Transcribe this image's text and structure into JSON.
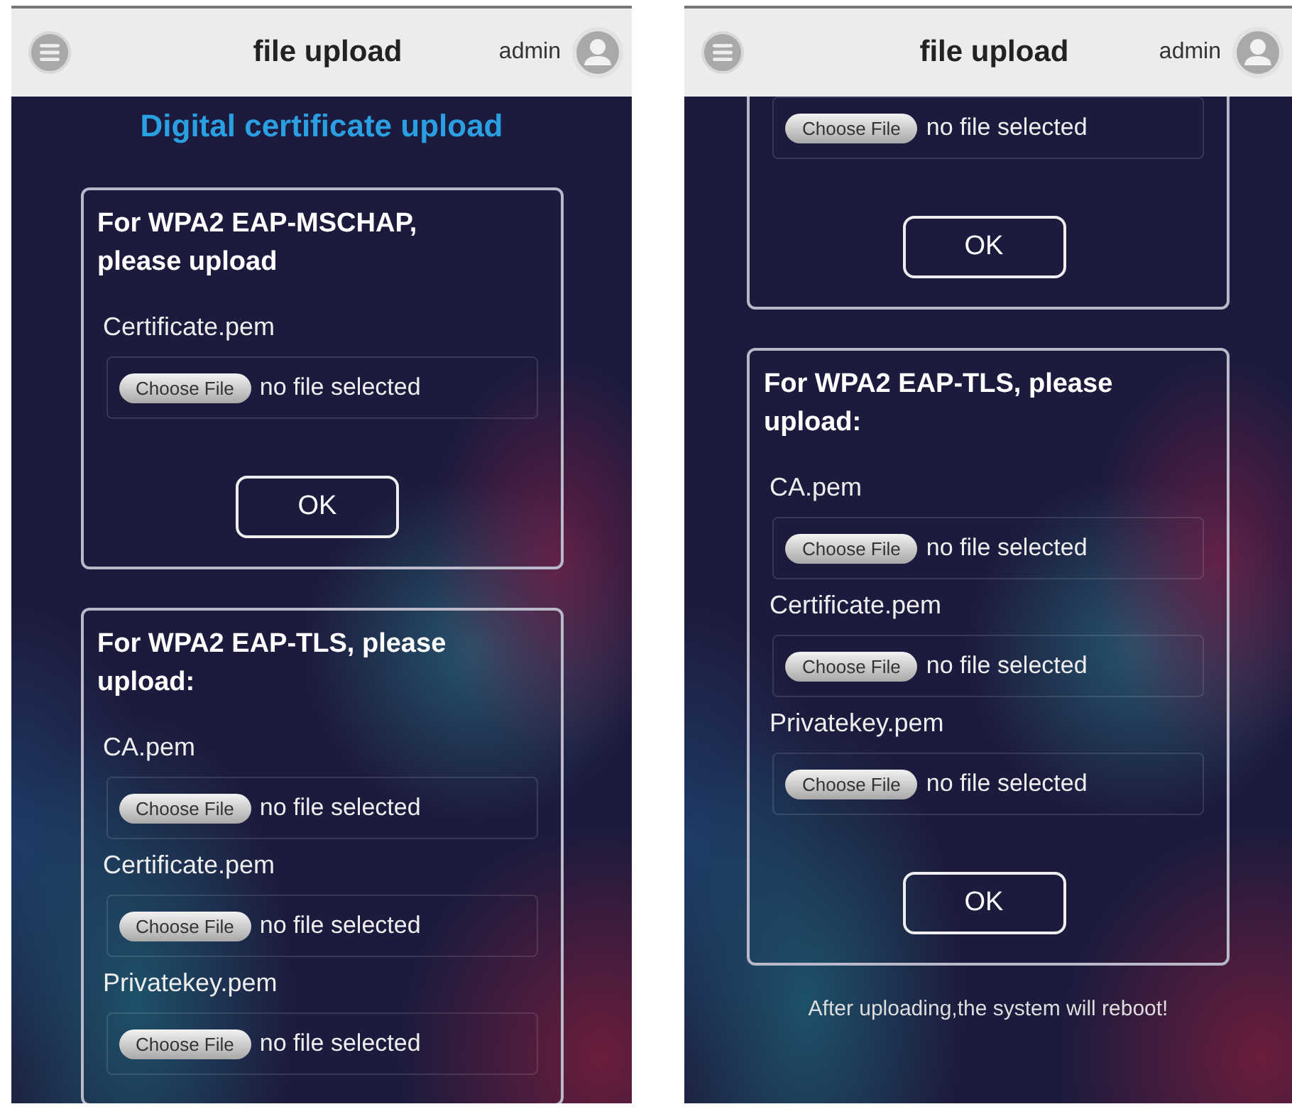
{
  "screens": [
    {
      "header": {
        "title": "file upload",
        "user": "admin"
      },
      "heading": "Digital certificate upload",
      "cards": [
        {
          "title": "For WPA2 EAP-MSCHAP, please upload",
          "top_cut": false,
          "rows": [
            {
              "label": "Certificate.pem",
              "button": "Choose File",
              "status": "no file selected"
            }
          ],
          "ok": "OK"
        },
        {
          "title": "For WPA2 EAP-TLS, please upload:",
          "top_cut": false,
          "rows": [
            {
              "label": "CA.pem",
              "button": "Choose File",
              "status": "no file selected"
            },
            {
              "label": "Certificate.pem",
              "button": "Choose File",
              "status": "no file selected"
            },
            {
              "label": "Privatekey.pem",
              "button": "Choose File",
              "status": "no file selected"
            }
          ]
        }
      ]
    },
    {
      "header": {
        "title": "file upload",
        "user": "admin"
      },
      "cards": [
        {
          "top_cut": true,
          "rows": [
            {
              "button": "Choose File",
              "status": "no file selected"
            }
          ],
          "ok": "OK"
        },
        {
          "title": "For WPA2 EAP-TLS, please upload:",
          "top_cut": false,
          "rows": [
            {
              "label": "CA.pem",
              "button": "Choose File",
              "status": "no file selected"
            },
            {
              "label": "Certificate.pem",
              "button": "Choose File",
              "status": "no file selected"
            },
            {
              "label": "Privatekey.pem",
              "button": "Choose File",
              "status": "no file selected"
            }
          ],
          "ok": "OK"
        }
      ],
      "note": "After uploading,the system will reboot!"
    }
  ]
}
